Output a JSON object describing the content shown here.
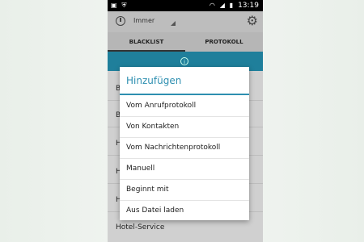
{
  "statusbar": {
    "time": "13:19",
    "left_icons": [
      "image-icon",
      "shield-icon"
    ],
    "right_icons": [
      "wifi-icon",
      "signal-icon",
      "battery-icon"
    ]
  },
  "toolbar": {
    "profile_label": "Immer"
  },
  "tabs": [
    {
      "label": "BLACKLIST"
    },
    {
      "label": "PROTOKOLL"
    }
  ],
  "background_list": {
    "partial_initials": [
      "B",
      "B",
      "H",
      "H",
      "H"
    ],
    "last_item": "Hotel-Service"
  },
  "dialog": {
    "title": "Hinzufügen",
    "options": [
      "Vom Anrufprotokoll",
      "Von Kontakten",
      "Vom Nachrichtenprotokoll",
      "Manuell",
      "Beginnt mit",
      "Aus Datei laden"
    ]
  },
  "colors": {
    "accent": "#2e8fb0",
    "infobar": "#1f7f9b",
    "statusbar": "#000000"
  }
}
